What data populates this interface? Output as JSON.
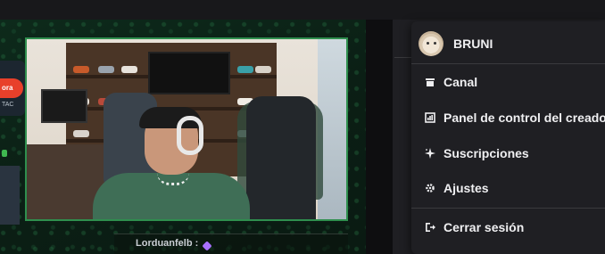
{
  "stream": {
    "overlay_left_pill": "ora",
    "overlay_left_sub": "TAC",
    "chat_username": "Lorduanfelb :"
  },
  "user_menu": {
    "username": "BRUNI",
    "items": [
      {
        "label": "Canal",
        "icon": "channel-icon"
      },
      {
        "label": "Panel de control del creador",
        "icon": "dashboard-icon"
      },
      {
        "label": "Suscripciones",
        "icon": "sparkle-icon"
      },
      {
        "label": "Ajustes",
        "icon": "gear-icon"
      },
      {
        "label": "Cerrar sesión",
        "icon": "logout-icon"
      }
    ]
  },
  "colors": {
    "menu_bg": "#1f1f23",
    "menu_text": "#efeff1",
    "stream_border": "#2f8f4e",
    "overlay_red": "#e8402a"
  }
}
